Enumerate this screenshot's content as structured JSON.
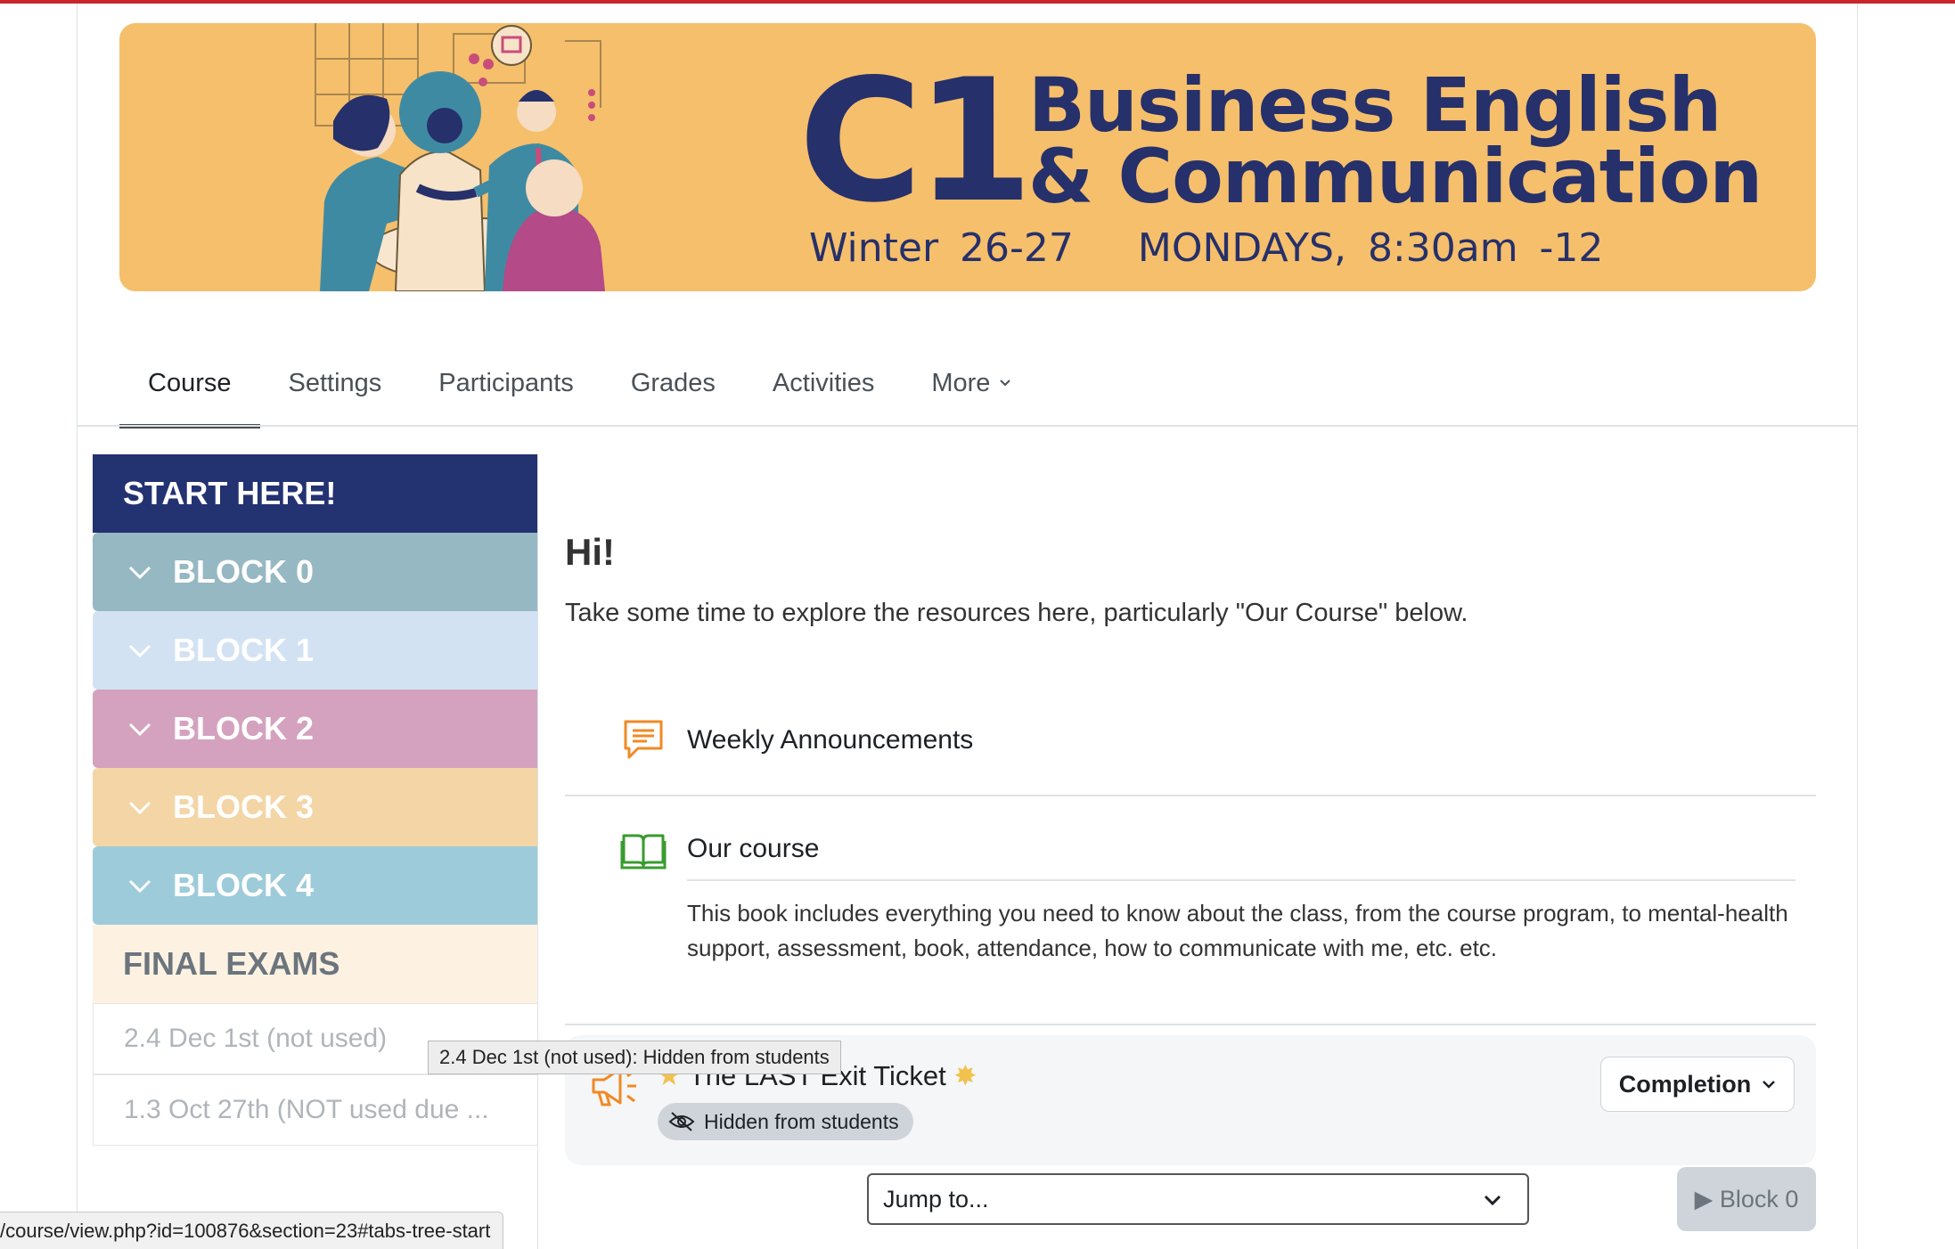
{
  "banner": {
    "title_c1": "C1",
    "title_line1": "Business English",
    "title_line2": "& Communication",
    "subtitle": "Winter 26-27   MONDAYS, 8:30am -12",
    "colors": {
      "background": "#f5bf6c",
      "text": "#26306a"
    }
  },
  "nav": {
    "tabs": [
      {
        "label": "Course",
        "active": true
      },
      {
        "label": "Settings",
        "active": false
      },
      {
        "label": "Participants",
        "active": false
      },
      {
        "label": "Grades",
        "active": false
      },
      {
        "label": "Activities",
        "active": false
      },
      {
        "label": "More",
        "active": false
      }
    ]
  },
  "sidebar": {
    "start": "START HERE!",
    "blocks": [
      {
        "label": "BLOCK 0",
        "color": "#96b8c2"
      },
      {
        "label": "BLOCK 1",
        "color": "#d3e2f3"
      },
      {
        "label": "BLOCK 2",
        "color": "#d4a2be"
      },
      {
        "label": "BLOCK 3",
        "color": "#f4d5a6"
      },
      {
        "label": "BLOCK 4",
        "color": "#9ecbd9"
      }
    ],
    "final": "FINAL EXAMS",
    "subitems": [
      "2.4 Dec 1st (not used)",
      "1.3 Oct 27th (NOT used due ..."
    ]
  },
  "main": {
    "title": "Hi!",
    "intro": "Take some time to explore the resources here, particularly \"Our Course\" below.",
    "activities": [
      {
        "name": "Weekly Announcements",
        "icon": "forum-icon"
      },
      {
        "name": "Our course",
        "icon": "book-icon",
        "description": "This book includes everything you need to know about the class, from the course program, to mental-health support, assessment, book, attendance, how to communicate with me, etc. etc."
      }
    ],
    "exit_ticket": {
      "title": "The LAST Exit Ticket",
      "badge": "Hidden from students",
      "completion_label": "Completion"
    },
    "tooltip": "2.4 Dec 1st (not used): Hidden from students",
    "jump_label": "Jump to...",
    "next_section": "▶ Block 0"
  },
  "status_url": "/course/view.php?id=100876&section=23#tabs-tree-start"
}
